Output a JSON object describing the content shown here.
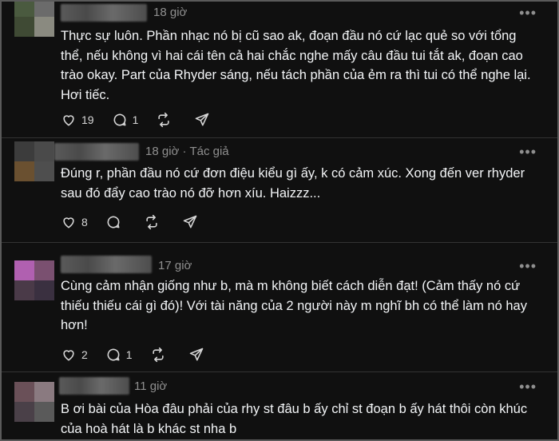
{
  "comments": [
    {
      "time": "18 giờ",
      "author_tag": "",
      "text": "Thực sự luôn. Phần nhạc nó bị cũ sao ak, đoạn đầu nó cứ lạc quẻ so với tổng thể, nếu không vì hai cái tên cả hai chắc nghe mấy câu đầu tui tắt ak, đoạn cao trào okay. Part của Rhyder sáng, nếu tách phần của ẻm ra thì tui có thể nghe lại. Hơi tiếc.",
      "likes": "19",
      "replies": "1",
      "avatar_colors": [
        "#4a5a3f",
        "#6b6b6b",
        "#3f4a34",
        "#8a8a80"
      ]
    },
    {
      "time": "18 giờ",
      "author_tag": "· Tác giả",
      "text": "Đúng r, phần đầu nó cứ đơn điệu kiểu gì ấy, k có cảm xúc. Xong đến ver rhyder sau đó đẩy cao trào nó đỡ hơn xíu. Haizzz...",
      "likes": "8",
      "replies": "",
      "avatar_colors": [
        "#3c3c3c",
        "#4a4a4a",
        "#6a5030",
        "#4e4e4e"
      ]
    },
    {
      "time": "17 giờ",
      "author_tag": "",
      "text": "Cùng cảm nhận giống như b, mà m không biết cách diễn đạt! (Cảm thấy nó cứ thiếu thiếu cái gì đó)! Với tài năng của 2 người này m nghĩ bh có thể làm nó hay hơn!",
      "likes": "2",
      "replies": "1",
      "avatar_colors": [
        "#b060b0",
        "#7a5070",
        "#4a3a48",
        "#3a3040"
      ]
    },
    {
      "time": "11 giờ",
      "author_tag": "",
      "text": "B ơi bài của Hòa đâu phải của rhy st đâu b ấy chỉ st đoạn b ấy hát thôi còn khúc của hoà hát là b khác st nha b",
      "likes": "",
      "replies": "",
      "avatar_colors": [
        "#6a5058",
        "#8a7a80",
        "#4a4048",
        "#5a5a5a"
      ]
    }
  ],
  "icons": {
    "more": "more-horizontal-icon",
    "like": "heart-icon",
    "reply": "comment-icon",
    "repost": "repost-icon",
    "share": "share-icon"
  }
}
